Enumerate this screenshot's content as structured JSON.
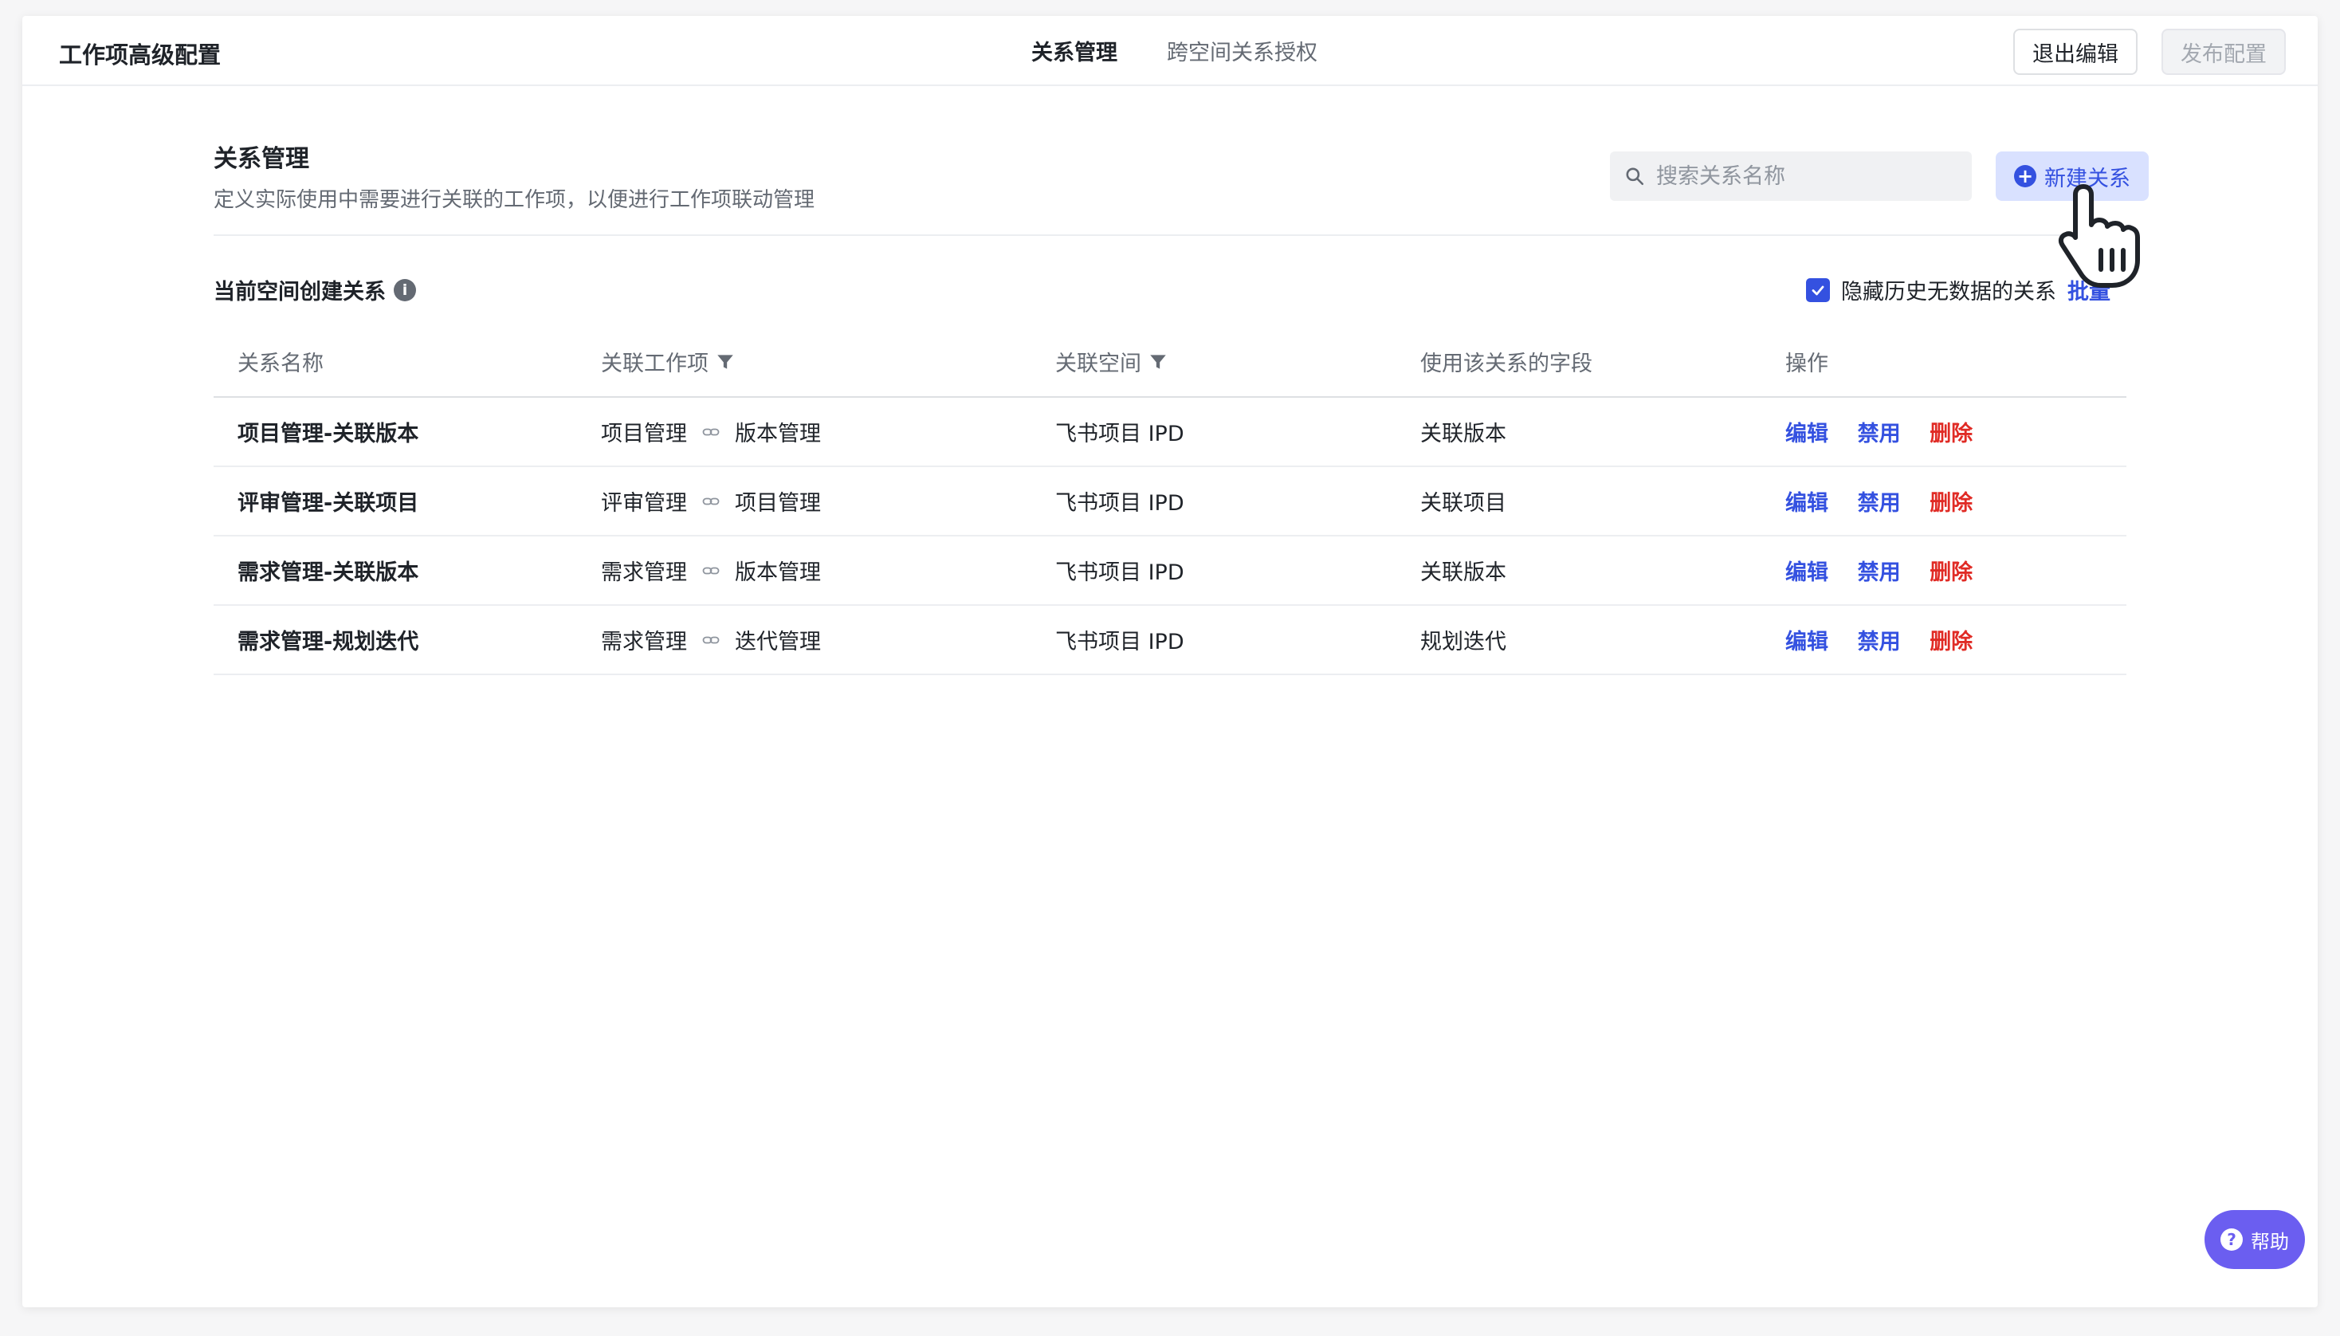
{
  "header": {
    "title": "工作项高级配置",
    "tabs": [
      {
        "label": "关系管理",
        "active": true
      },
      {
        "label": "跨空间关系授权",
        "active": false
      }
    ],
    "exit_label": "退出编辑",
    "publish_label": "发布配置"
  },
  "section": {
    "title": "关系管理",
    "description": "定义实际使用中需要进行关联的工作项，以便进行工作项联动管理",
    "search_placeholder": "搜索关系名称",
    "new_button_label": "新建关系"
  },
  "subsection": {
    "title": "当前空间创建关系",
    "hide_label": "隐藏历史无数据的关系",
    "hide_checked": true,
    "batch_label": "批量"
  },
  "table": {
    "columns": [
      "关系名称",
      "关联工作项",
      "关联空间",
      "使用该关系的字段",
      "操作"
    ],
    "rows": [
      {
        "name": "项目管理-关联版本",
        "from": "项目管理",
        "to": "版本管理",
        "space": "飞书项目 IPD",
        "field": "关联版本"
      },
      {
        "name": "评审管理-关联项目",
        "from": "评审管理",
        "to": "项目管理",
        "space": "飞书项目 IPD",
        "field": "关联项目"
      },
      {
        "name": "需求管理-关联版本",
        "from": "需求管理",
        "to": "版本管理",
        "space": "飞书项目 IPD",
        "field": "关联版本"
      },
      {
        "name": "需求管理-规划迭代",
        "from": "需求管理",
        "to": "迭代管理",
        "space": "飞书项目 IPD",
        "field": "规划迭代"
      }
    ],
    "actions": {
      "edit": "编辑",
      "disable": "禁用",
      "delete": "删除"
    }
  },
  "help_label": "帮助",
  "colors": {
    "primary": "#3451e0",
    "danger": "#e02b25",
    "help": "#6b5ef0"
  }
}
